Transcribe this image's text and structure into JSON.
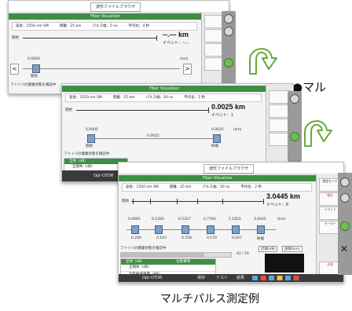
{
  "screen1": {
    "window_title": "波形ファイルブラウザ",
    "header": "Fiber Visualizer",
    "params": [
      "波長：1550 nm SM",
      "距離：25 km",
      "パルス幅：5 ns",
      "平均化：4 秒"
    ],
    "start_label": "開始",
    "distance": "--.--- km",
    "event": "イベント：--.--",
    "scale_left": "0.0000",
    "scale_unit": "(km)",
    "start_mark": "開始",
    "nav_prev": "<",
    "nav_next": ">",
    "fiber_label": "ファイバの健康状態を確認中"
  },
  "screen2": {
    "header": "Fiber Visualizer",
    "params": [
      "波長：1550 nm SM",
      "距離：25 km",
      "パルス幅：20 ns",
      "平均化：2 秒"
    ],
    "start_label": "開始",
    "distance": "0.0025 km",
    "event": "イベント：1",
    "scale_left": "0.0000",
    "scale_mid": "0.0025",
    "scale_right": "0.0025",
    "scale_unit": "(km)",
    "start_mark": "開始",
    "end_mark": "終端",
    "fiber_label": "ファイバの健康状態を確認中",
    "list_header": "全体（dB）",
    "list_rows": [
      "全損失（dB）",
      "全反射減衰量（dB）"
    ],
    "app_name": "Opt-OTDR"
  },
  "screen3": {
    "window_title": "波形ファイルブラウザ",
    "header": "Fiber Visualizer",
    "params": [
      "波長：1550 nm SM",
      "距離：25 km",
      "パルス幅：50 ns",
      "平均化：2 秒"
    ],
    "start_label": "開始",
    "distance": "3.0445 km",
    "event": "イベント：8",
    "scale_top": [
      "0.0081",
      "0.1283",
      "0.5327",
      "0.7783",
      "1.1855",
      "3.0445"
    ],
    "scale_unit": "(km)",
    "scale_bottom": [
      "0.249",
      "0.103",
      "0.358",
      "0.170",
      "0.047"
    ],
    "end_mark": "終端",
    "fiber_label": "ファイバの健康状態を確認中",
    "progress": "42 / 55",
    "tab_a": "近端(dB)",
    "tab_b": "遠端(km)",
    "list_header": "全体（dB）",
    "list_header2": "注意事項",
    "list_rows": [
      "全損失（dB）",
      "全反射減衰量（dB）"
    ],
    "app_name": "Opt-OTDR",
    "bottom_items": [
      "保存",
      "テスト",
      "結果"
    ],
    "right_buttons": [
      "測定モード",
      "保存",
      "イベント",
      "マーカー",
      "光源"
    ]
  },
  "caption_multi": "●マル",
  "caption_bottom": "マルチパルス測定例",
  "colors": {
    "green": "#3f8e43",
    "arrow": "#7ab648"
  }
}
